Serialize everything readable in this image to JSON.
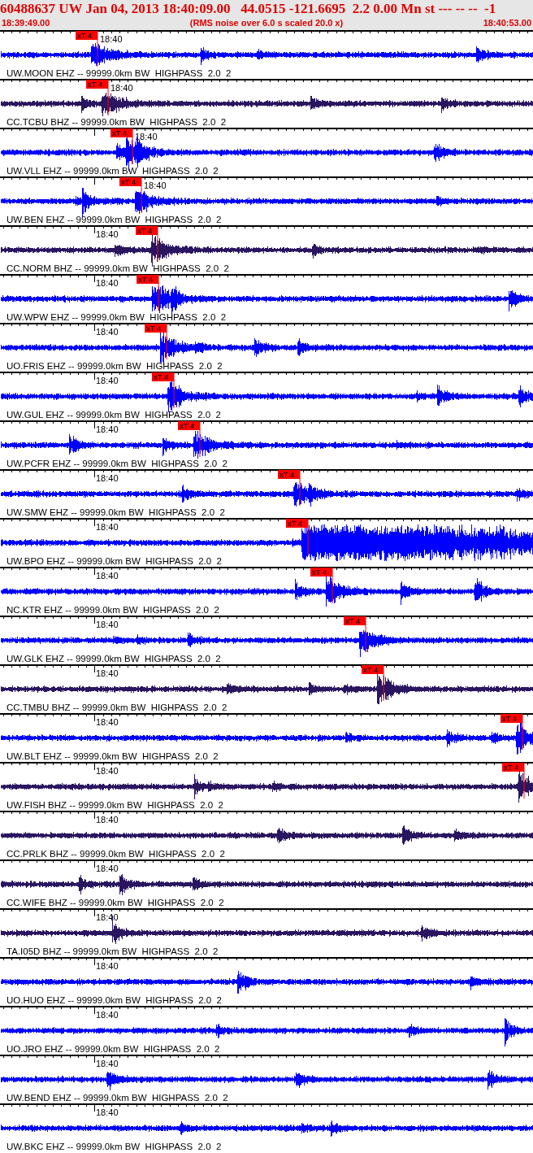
{
  "header": {
    "title": "60488637 UW Jan 04, 2013 18:40:09.00   44.0515 -121.6695  2.2 0.00 Mn st --- -- --  -1",
    "start_time": "18:39:49.00",
    "note": "(RMS noise over 6.0 s scaled 20.0 x)",
    "end_time": "18:40:53.00"
  },
  "traces": [
    {
      "label": "UW.MOON EHZ -- 99999.0km BW  HIGHPASS  2.0  2",
      "time_label": "18:40",
      "color": "#0000ff",
      "pick": {
        "label": "xT 4"
      }
    },
    {
      "label": "CC.TCBU BHZ -- 99999.0km BW  HIGHPASS  2.0  2",
      "time_label": "18:40",
      "color": "#2a1560",
      "pick": {
        "label": "xT 4"
      }
    },
    {
      "label": "UW.VLL EHZ -- 99999.0km BW  HIGHPASS  2.0  2",
      "time_label": "18:40",
      "color": "#0000ff",
      "pick": {
        "label": "xT 4"
      }
    },
    {
      "label": "UW.BEN EHZ -- 99999.0km BW  HIGHPASS  2.0  2",
      "time_label": "18:40",
      "color": "#0000ff",
      "pick": {
        "label": "xT 4"
      }
    },
    {
      "label": "CC.NORM BHZ -- 99999.0km BW  HIGHPASS  2.0  2",
      "time_label": "18:40",
      "color": "#2a1560",
      "pick": {
        "label": "xT 4"
      }
    },
    {
      "label": "UW.WPW EHZ -- 99999.0km BW  HIGHPASS  2.0  2",
      "time_label": "18:40",
      "color": "#0000ff",
      "pick": {
        "label": "xT 4"
      }
    },
    {
      "label": "UO.FRIS EHZ -- 99999.0km BW  HIGHPASS  2.0  2",
      "time_label": "18:40",
      "color": "#0000ff",
      "pick": {
        "label": "xT 4"
      }
    },
    {
      "label": "UW.GUL EHZ -- 99999.0km BW  HIGHPASS  2.0  2",
      "time_label": "18:40",
      "color": "#0000ff",
      "pick": {
        "label": "xT 4"
      }
    },
    {
      "label": "UW.PCFR EHZ -- 99999.0km BW  HIGHPASS  2.0  2",
      "time_label": "18:40",
      "color": "#0000ff",
      "pick": {
        "label": "xT 4"
      }
    },
    {
      "label": "UW.SMW EHZ -- 99999.0km BW  HIGHPASS  2.0  2",
      "time_label": "18:40",
      "color": "#0000ff",
      "pick": {
        "label": "xT 4"
      }
    },
    {
      "label": "UW.BPO EHZ -- 99999.0km BW  HIGHPASS  2.0  2",
      "time_label": "18:40",
      "color": "#0000ff",
      "pick": {
        "label": "xT 4"
      }
    },
    {
      "label": "NC.KTR EHZ -- 99999.0km BW  HIGHPASS  2.0  2",
      "time_label": "18:40",
      "color": "#0000ff",
      "pick": {
        "label": "xT 4"
      }
    },
    {
      "label": "UW.GLK EHZ -- 99999.0km BW  HIGHPASS  2.0  2",
      "time_label": "18:40",
      "color": "#0000ff",
      "pick": {
        "label": "xT 4"
      }
    },
    {
      "label": "CC.TMBU BHZ -- 99999.0km BW  HIGHPASS  2.0  2",
      "time_label": "18:40",
      "color": "#2a1560",
      "pick": {
        "label": "xT 4"
      }
    },
    {
      "label": "UW.BLT EHZ -- 99999.0km BW  HIGHPASS  2.0  2",
      "time_label": "18:40",
      "color": "#0000ff",
      "pick": {
        "label": "xT 4"
      }
    },
    {
      "label": "UW.FISH BHZ -- 99999.0km BW  HIGHPASS  2.0  2",
      "time_label": "18:40",
      "color": "#2a1560",
      "pick": {
        "label": "xT 4"
      }
    },
    {
      "label": "CC.PRLK BHZ -- 99999.0km BW  HIGHPASS  2.0  2",
      "time_label": "18:40",
      "color": "#2a1560"
    },
    {
      "label": "CC.WIFE BHZ -- 99999.0km BW  HIGHPASS  2.0  2",
      "time_label": "18:40",
      "color": "#2a1560"
    },
    {
      "label": "TA.I05D BHZ -- 99999.0km BW  HIGHPASS  2.0  2",
      "time_label": "18:40",
      "color": "#2a1560"
    },
    {
      "label": "UO.HUO EHZ -- 99999.0km BW  HIGHPASS  2.0  2",
      "time_label": "18:40",
      "color": "#0000ff"
    },
    {
      "label": "UO.JRO EHZ -- 99999.0km BW  HIGHPASS  2.0  2",
      "time_label": "18:40",
      "color": "#0000ff"
    },
    {
      "label": "UW.BEND EHZ -- 99999.0km BW  HIGHPASS  2.0  2",
      "time_label": "18:40",
      "color": "#0000ff"
    },
    {
      "label": "UW.BKC EHZ -- 99999.0km BW  HIGHPASS  2.0  2",
      "time_label": "18:40",
      "color": "#0000ff"
    }
  ]
}
